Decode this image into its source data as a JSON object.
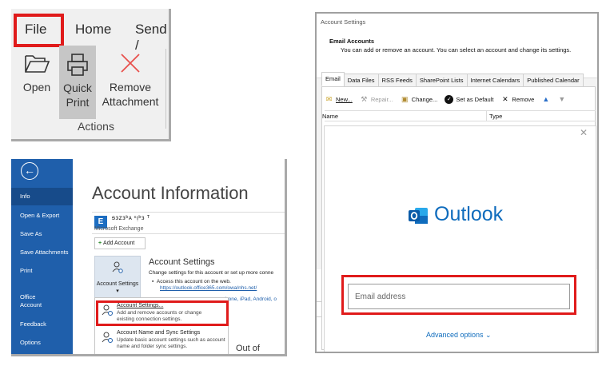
{
  "ribbon": {
    "tabs": [
      "File",
      "Home",
      "Send /"
    ],
    "buttons": {
      "open": "Open",
      "quick_print": "Quick\nPrint",
      "remove_attachment": "Remove\nAttachment"
    },
    "group_label": "Actions",
    "highlight_color": "#e01b1b"
  },
  "backstage": {
    "nav": {
      "info": "Info",
      "open_export": "Open & Export",
      "save_as": "Save As",
      "save_attachments": "Save Attachments",
      "print": "Print",
      "office_account": "Office Account",
      "feedback": "Feedback",
      "options": "Options"
    },
    "title": "Account Information",
    "account_name": "ᵴᴈᴢᴈᵇᴀ ᵋᴉᵇᴈ ᵀ",
    "account_type": "Microsoft Exchange",
    "add_account": "Add Account",
    "account_settings_button": "Account Settings ▾",
    "account_settings": {
      "heading": "Account Settings",
      "description": "Change settings for this account or set up more conne",
      "bullet": "Access this account on the web.",
      "url": "https://outlook.office365.com/owa/nhs.net/",
      "ios_text": "hone, iPad, Android, o"
    },
    "dropdown": [
      {
        "title": "Account Settings...",
        "description": "Add and remove accounts or change existing connection settings."
      },
      {
        "title": "Account Name and Sync Settings",
        "description": "Update basic account settings such as account name and folder sync settings."
      }
    ],
    "out_of_office": "Out of Office)",
    "nav_color": "#1f5fab"
  },
  "dialog": {
    "window_title": "Account Settings",
    "heading": "Email Accounts",
    "description": "You can add or remove an account. You can select an account and change its settings.",
    "tabs": [
      "Email",
      "Data Files",
      "RSS Feeds",
      "SharePoint Lists",
      "Internet Calendars",
      "Published Calendar"
    ],
    "toolbar": {
      "new": "New...",
      "repair": "Repair...",
      "change": "Change...",
      "set_default": "Set as Default",
      "remove": "Remove"
    },
    "columns": [
      "Name",
      "Type"
    ],
    "brand": "Outlook",
    "email_placeholder": "Email address",
    "advanced_options": "Advanced options ⌄",
    "brand_color": "#0f6cbd"
  }
}
